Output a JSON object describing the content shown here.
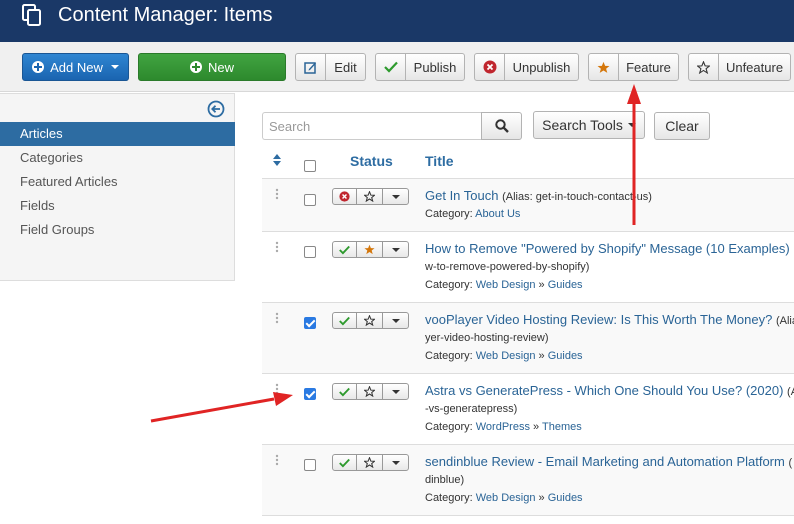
{
  "header": {
    "title": "Content Manager: Items",
    "icon": "copy-icon",
    "bg_color": "#1a3867"
  },
  "toolbar": {
    "add_new_label": "Add New",
    "new_label": "New",
    "edit_label": "Edit",
    "publish_label": "Publish",
    "unpublish_label": "Unpublish",
    "feature_label": "Feature",
    "unfeature_label": "Unfeature"
  },
  "sidebar": {
    "items": [
      {
        "label": "Articles",
        "active": true
      },
      {
        "label": "Categories"
      },
      {
        "label": "Featured Articles"
      },
      {
        "label": "Fields"
      },
      {
        "label": "Field Groups"
      }
    ]
  },
  "search": {
    "placeholder": "Search",
    "value": "",
    "tools_label": "Search Tools",
    "clear_label": "Clear"
  },
  "table": {
    "columns": {
      "status": "Status",
      "title": "Title"
    },
    "rows": [
      {
        "title": "Get In Touch",
        "alias": "(Alias: get-in-touch-contact-us)",
        "category_prefix": "Category: ",
        "category": "About Us",
        "published": false,
        "featured": false,
        "checked": false
      },
      {
        "title": "How to Remove \"Powered by Shopify\" Message (10 Examples)",
        "alias": "w-to-remove-powered-by-shopify)",
        "category_prefix": "Category: ",
        "category": "Web Design",
        "category_sep": " » ",
        "subcategory": "Guides",
        "published": true,
        "featured": true,
        "checked": false
      },
      {
        "title": "vooPlayer Video Hosting Review: Is This Worth The Money?",
        "title_suffix": "(Alia",
        "alias": "yer-video-hosting-review)",
        "category_prefix": "Category: ",
        "category": "Web Design",
        "category_sep": " » ",
        "subcategory": "Guides",
        "published": true,
        "featured": false,
        "checked": true
      },
      {
        "title": "Astra vs GeneratePress - Which One Should You Use? (2020)",
        "title_suffix": "(A",
        "alias": "-vs-generatepress)",
        "category_prefix": "Category: ",
        "category": "WordPress",
        "category_sep": " » ",
        "subcategory": "Themes",
        "published": true,
        "featured": false,
        "checked": true
      },
      {
        "title": "sendinblue Review - Email Marketing and Automation Platform",
        "title_suffix": "(",
        "alias": "dinblue)",
        "category_prefix": "Category: ",
        "category": "Web Design",
        "category_sep": " » ",
        "subcategory": "Guides",
        "published": true,
        "featured": false,
        "checked": false
      }
    ]
  },
  "annotations": {
    "arrow_color": "#e02424"
  },
  "colors": {
    "link": "#2a6496",
    "active_nav": "#2d6ca2",
    "publish_green": "#2e9a2e",
    "unpublish_red": "#c0262e",
    "star_orange": "#d4770c"
  }
}
